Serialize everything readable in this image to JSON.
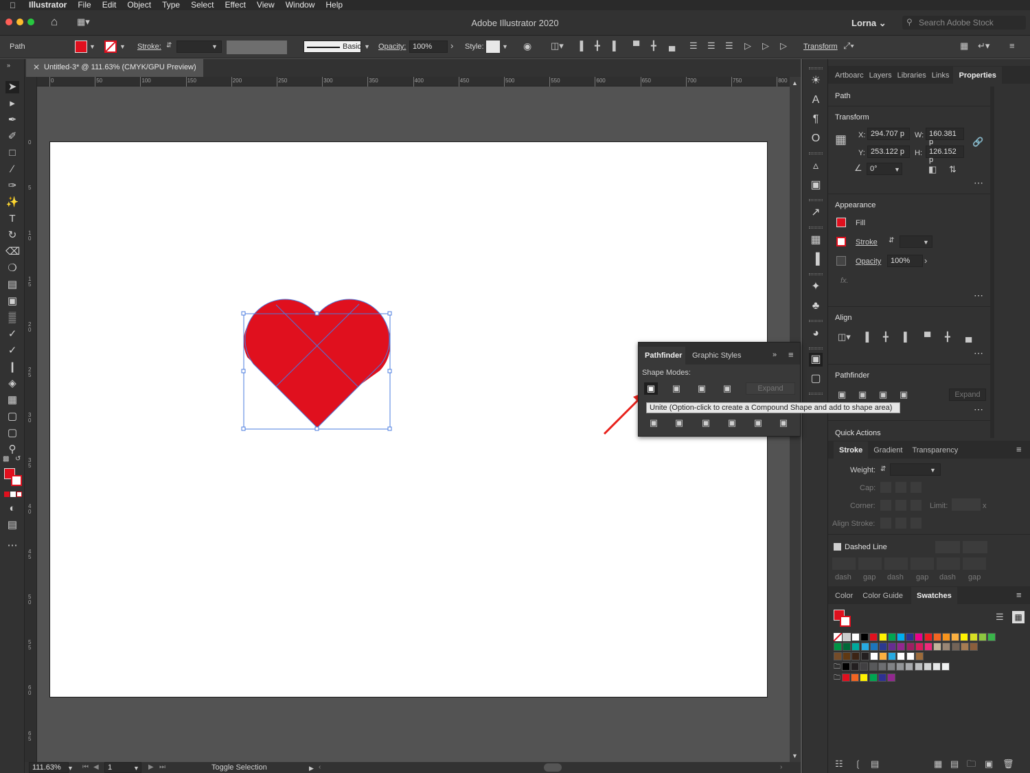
{
  "menubar": {
    "app": "Illustrator",
    "items": [
      "File",
      "Edit",
      "Object",
      "Type",
      "Select",
      "Effect",
      "View",
      "Window",
      "Help"
    ]
  },
  "titlebar": {
    "title": "Adobe Illustrator 2020",
    "user": "Lorna",
    "search_placeholder": "Search Adobe Stock"
  },
  "controlbar": {
    "selection_type": "Path",
    "stroke_label": "Stroke:",
    "brush_label": "Basic",
    "opacity_label": "Opacity:",
    "opacity_value": "100%",
    "style_label": "Style:",
    "transform_link": "Transform"
  },
  "document": {
    "tab_title": "Untitled-3* @ 111.63% (CMYK/GPU Preview)"
  },
  "ruler": {
    "h_ticks": [
      "0",
      "50",
      "100",
      "150",
      "200",
      "250",
      "300",
      "350",
      "400",
      "450",
      "500",
      "550",
      "600",
      "650",
      "700",
      "750",
      "800"
    ],
    "v_ticks": [
      "0",
      "5",
      "1 0",
      "1 5",
      "2 0",
      "2 5",
      "3 0",
      "3 5",
      "4 0",
      "4 5",
      "5 0",
      "5 5",
      "6 0",
      "6 5"
    ]
  },
  "status": {
    "zoom": "111.63%",
    "artboard_num": "1",
    "mode": "Toggle Selection"
  },
  "colors": {
    "fill": "#e0101e",
    "accent_blue": "#4a7bdf"
  },
  "panel": {
    "tabs": [
      "Artboarc",
      "Layers",
      "Libraries",
      "Links",
      "Properties"
    ],
    "active_tab": "Properties",
    "object_type": "Path",
    "transform": {
      "title": "Transform",
      "x_label": "X:",
      "x": "294.707 p",
      "y_label": "Y:",
      "y": "253.122 p",
      "w_label": "W:",
      "w": "160.381 p",
      "h_label": "H:",
      "h": "126.152 p",
      "angle": "0°"
    },
    "appearance": {
      "title": "Appearance",
      "fill_label": "Fill",
      "stroke_label": "Stroke",
      "opacity_label": "Opacity",
      "opacity_value": "100%",
      "fx_label": "fx."
    },
    "align_title": "Align",
    "pathfinder_title": "Pathfinder",
    "expand_label": "Expand",
    "quick_actions_title": "Quick Actions"
  },
  "stroke_panel": {
    "tabs": [
      "Stroke",
      "Gradient",
      "Transparency"
    ],
    "weight_label": "Weight:",
    "cap_label": "Cap:",
    "corner_label": "Corner:",
    "limit_label": "Limit:",
    "limit_suffix": "x",
    "align_label": "Align Stroke:",
    "dashed_label": "Dashed Line",
    "dash_labels": [
      "dash",
      "gap",
      "dash",
      "gap",
      "dash",
      "gap"
    ]
  },
  "swatches_panel": {
    "tabs": [
      "Color",
      "Color Guide",
      "Swatches"
    ],
    "row1": [
      "#ffffff",
      "#000000",
      "#e0101e",
      "#fff200",
      "#00a651",
      "#00aeef",
      "#2e3192",
      "#ec008c",
      "#ed1c24",
      "#f26522",
      "#f7941d",
      "#fbb040",
      "#fff200",
      "#d7df23",
      "#8dc63f",
      "#39b54a"
    ],
    "row2": [
      "#009444",
      "#006838",
      "#00a99d",
      "#27aae1",
      "#1c75bc",
      "#2b3990",
      "#662d91",
      "#92278f",
      "#9e1f63",
      "#da1c5c",
      "#ee2a7b",
      "#c2b59b",
      "#998675",
      "#736357",
      "#a67c52",
      "#8b5e3c"
    ],
    "row3": [
      "#754c29",
      "#603913",
      "#3c2415",
      "#231f20",
      "#ffffff",
      "#fbb040",
      "#27aae1",
      "#ffffff",
      "#ffffff",
      "#9e6b3a"
    ],
    "row4": [
      "#000000",
      "#231f20",
      "#414042",
      "#58595b",
      "#6d6e71",
      "#808285",
      "#939598",
      "#a7a9ac",
      "#bcbec0",
      "#d1d3d4",
      "#e6e7e8",
      "#f1f2f2"
    ],
    "row5": [
      "#e0101e",
      "#f26522",
      "#fff200",
      "#00a651",
      "#2e3192",
      "#92278f"
    ]
  },
  "pathfinder_panel": {
    "tabs": [
      "Pathfinder",
      "Graphic Styles"
    ],
    "shape_modes_label": "Shape Modes:",
    "expand_label": "Expand",
    "tooltip": "Unite (Option-click to create a Compound Shape and add to shape area)"
  }
}
